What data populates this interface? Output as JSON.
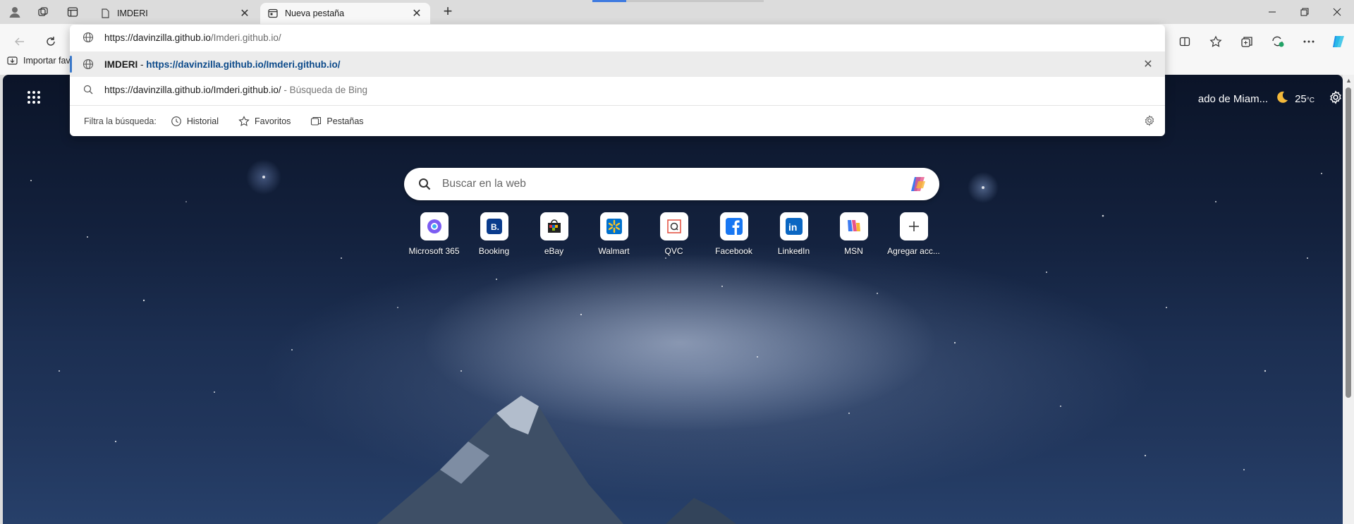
{
  "tabs": [
    {
      "title": "IMDERI",
      "active": false
    },
    {
      "title": "Nueva pestaña",
      "active": true
    }
  ],
  "omnibox": {
    "input_domain": "https://davinzilla.github.io",
    "input_path": "/Imderi.github.io/",
    "suggestion_title": "IMDERI",
    "suggestion_sep": " - ",
    "suggestion_url": "https://davinzilla.github.io/Imderi.github.io/",
    "bing_query": "https://davinzilla.github.io/Imderi.github.io/",
    "bing_suffix": " - Búsqueda de Bing",
    "filter_label": "Filtra la búsqueda:",
    "filters": [
      "Historial",
      "Favoritos",
      "Pestañas"
    ]
  },
  "favorites_bar": {
    "import_label": "Importar fav"
  },
  "newtab": {
    "weather_city": "ado de Miam...",
    "weather_temp": "25",
    "weather_unit": "°C",
    "search_placeholder": "Buscar en la web",
    "tiles": [
      {
        "label": "Microsoft 365",
        "icon": "microsoft365-icon"
      },
      {
        "label": "Booking",
        "icon": "booking-icon"
      },
      {
        "label": "eBay",
        "icon": "ebay-icon"
      },
      {
        "label": "Walmart",
        "icon": "walmart-icon"
      },
      {
        "label": "QVC",
        "icon": "qvc-icon"
      },
      {
        "label": "Facebook",
        "icon": "facebook-icon"
      },
      {
        "label": "LinkedIn",
        "icon": "linkedin-icon"
      },
      {
        "label": "MSN",
        "icon": "msn-icon"
      },
      {
        "label": "Agregar acc...",
        "icon": "add-icon"
      }
    ]
  },
  "colors": {
    "accent": "#3a78c9",
    "url_link": "#0c4a8a",
    "tab_bg": "#dcdcdc",
    "toolbar_bg": "#f7f7f7"
  }
}
